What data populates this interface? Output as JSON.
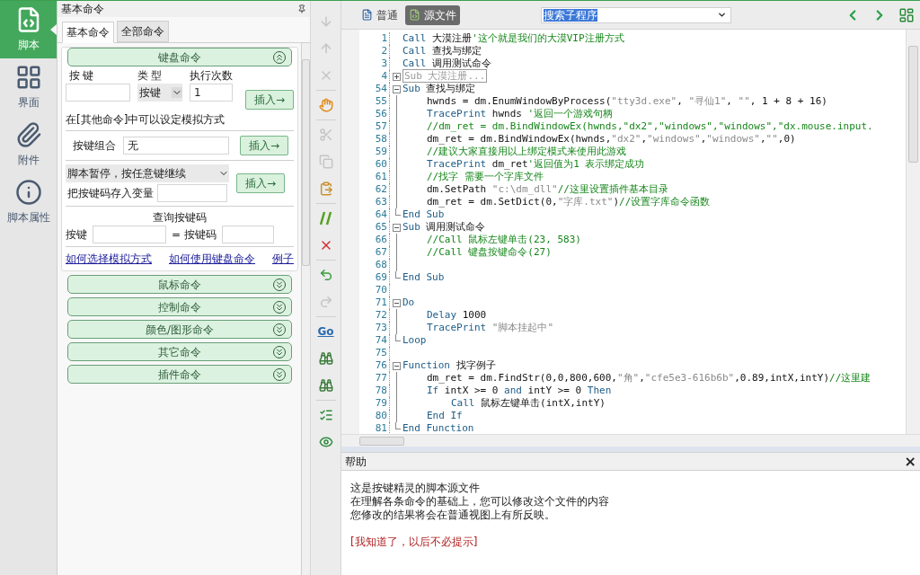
{
  "nav": [
    {
      "label": "脚本",
      "selected": true
    },
    {
      "label": "界面",
      "selected": false
    },
    {
      "label": "附件",
      "selected": false
    },
    {
      "label": "脚本属性",
      "selected": false
    }
  ],
  "panel": {
    "title": "基本命令",
    "tabs": [
      {
        "label": "基本命令",
        "selected": true
      },
      {
        "label": "全部命令",
        "selected": false
      }
    ],
    "sections": [
      {
        "title": "键盘命令",
        "expanded": true
      },
      {
        "title": "鼠标命令",
        "expanded": false
      },
      {
        "title": "控制命令",
        "expanded": false
      },
      {
        "title": "颜色/图形命令",
        "expanded": false
      },
      {
        "title": "其它命令",
        "expanded": false
      },
      {
        "title": "插件命令",
        "expanded": false
      }
    ],
    "keyboard": {
      "col_key": "按键",
      "col_type": "类型",
      "col_count": "执行次数",
      "type_value": "按键",
      "count_value": "1",
      "insert": "插入→",
      "note": "在[其他命令]中可以设定模拟方式",
      "combo_label": "按键组合",
      "combo_value": "无",
      "combo_insert": "插入→",
      "pause_value": "脚本暂停，按任意键继续",
      "store_label": "把按键码存入变量",
      "pause_insert": "插入→",
      "query_title": "查询按键码",
      "query_key": "按键",
      "query_code": "= 按键码",
      "links": [
        "如何选择模拟方式",
        "如何使用键盘命令",
        "例子"
      ]
    }
  },
  "tools": [
    {
      "disabled": true
    },
    {
      "disabled": true
    },
    {
      "disabled": true
    },
    {
      "disabled": false
    },
    {
      "disabled": true
    },
    {
      "disabled": true
    },
    {
      "disabled": false
    },
    {
      "disabled": false
    },
    {
      "disabled": false
    },
    {
      "disabled": false
    },
    {
      "disabled": true
    },
    {
      "disabled": false,
      "label": "Go"
    },
    {
      "disabled": false
    },
    {
      "disabled": false
    },
    {
      "disabled": false
    },
    {
      "disabled": false
    }
  ],
  "view_tabs": [
    {
      "label": "普通",
      "selected": false
    },
    {
      "label": "源文件",
      "selected": true
    }
  ],
  "sub_search": {
    "value": "搜索子程序"
  },
  "code": [
    {
      "no": "1",
      "kind": "line",
      "tokens": [
        {
          "kind": "keyword",
          "t": "Call"
        },
        {
          "kind": "text",
          "t": " 大漠注册"
        },
        {
          "kind": "comment",
          "t": "'这个就是我们的大漠VIP注册方式"
        }
      ]
    },
    {
      "no": "2",
      "kind": "line",
      "tokens": [
        {
          "kind": "keyword",
          "t": "Call"
        },
        {
          "kind": "text",
          "t": " 查找与绑定"
        }
      ]
    },
    {
      "no": "3",
      "kind": "line",
      "tokens": [
        {
          "kind": "keyword",
          "t": "Call"
        },
        {
          "kind": "text",
          "t": " 调用测试命令"
        }
      ]
    },
    {
      "no": "4",
      "kind": "block",
      "expanded": false,
      "tokens": [
        {
          "kind": "folded",
          "t": "Sub 大漠注册..."
        }
      ]
    },
    {
      "no": "54",
      "kind": "block",
      "expanded": true,
      "tokens": [
        {
          "kind": "keyword",
          "t": "Sub"
        },
        {
          "kind": "text",
          "t": " 查找与绑定"
        }
      ],
      "children": [
        {
          "no": "55",
          "kind": "line",
          "tokens": [
            {
              "kind": "text",
              "t": "hwnds = dm.EnumWindowByProcess("
            },
            {
              "kind": "string",
              "t": "\"tty3d.exe\""
            },
            {
              "kind": "text",
              "t": ", "
            },
            {
              "kind": "string",
              "t": "\"寻仙1\""
            },
            {
              "kind": "text",
              "t": ", "
            },
            {
              "kind": "string",
              "t": "\"\""
            },
            {
              "kind": "text",
              "t": ", 1 + 8 + 16)"
            }
          ]
        },
        {
          "no": "56",
          "kind": "line",
          "tokens": [
            {
              "kind": "keyword",
              "t": "TracePrint"
            },
            {
              "kind": "text",
              "t": " hwnds "
            },
            {
              "kind": "comment",
              "t": "'返回一个游戏句柄"
            }
          ]
        },
        {
          "no": "57",
          "kind": "line",
          "tokens": [
            {
              "kind": "comment",
              "t": "//dm_ret = dm.BindWindowEx(hwnds,\"dx2\",\"windows\",\"windows\",\"dx.mouse.input."
            }
          ]
        },
        {
          "no": "58",
          "kind": "line",
          "tokens": [
            {
              "kind": "text",
              "t": "dm_ret = dm.BindWindowEx(hwnds,"
            },
            {
              "kind": "string",
              "t": "\"dx2\""
            },
            {
              "kind": "text",
              "t": ","
            },
            {
              "kind": "string",
              "t": "\"windows\""
            },
            {
              "kind": "text",
              "t": ","
            },
            {
              "kind": "string",
              "t": "\"windows\""
            },
            {
              "kind": "text",
              "t": ","
            },
            {
              "kind": "string",
              "t": "\"\""
            },
            {
              "kind": "text",
              "t": ",0)"
            }
          ]
        },
        {
          "no": "59",
          "kind": "line",
          "tokens": [
            {
              "kind": "comment",
              "t": "//建议大家直接用以上绑定模式来使用此游戏"
            }
          ]
        },
        {
          "no": "60",
          "kind": "line",
          "tokens": [
            {
              "kind": "keyword",
              "t": "TracePrint"
            },
            {
              "kind": "text",
              "t": " dm_ret"
            },
            {
              "kind": "comment",
              "t": "'返回值为1 表示绑定成功"
            }
          ]
        },
        {
          "no": "61",
          "kind": "line",
          "tokens": [
            {
              "kind": "comment",
              "t": "//找字 需要一个字库文件"
            }
          ]
        },
        {
          "no": "62",
          "kind": "line",
          "tokens": [
            {
              "kind": "text",
              "t": "dm.SetPath "
            },
            {
              "kind": "string",
              "t": "\"c:\\dm_dll\""
            },
            {
              "kind": "comment",
              "t": "//这里设置插件基本目录"
            }
          ]
        },
        {
          "no": "63",
          "kind": "line",
          "tokens": [
            {
              "kind": "text",
              "t": "dm_ret = dm.SetDict(0,"
            },
            {
              "kind": "string",
              "t": "\"字库.txt\""
            },
            {
              "kind": "text",
              "t": ")"
            },
            {
              "kind": "comment",
              "t": "//设置字库命令函数"
            }
          ]
        }
      ]
    },
    {
      "no": "64",
      "kind": "end",
      "tokens": [
        {
          "kind": "keyword",
          "t": "End Sub"
        }
      ]
    },
    {
      "no": "65",
      "kind": "block",
      "expanded": true,
      "tokens": [
        {
          "kind": "keyword",
          "t": "Sub"
        },
        {
          "kind": "text",
          "t": " 调用测试命令"
        }
      ],
      "children": [
        {
          "no": "66",
          "kind": "line",
          "tokens": [
            {
              "kind": "comment",
              "t": "//Call 鼠标左键单击(23, 583)"
            }
          ]
        },
        {
          "no": "67",
          "kind": "line",
          "tokens": [
            {
              "kind": "comment",
              "t": "//Call 键盘按键命令(27)"
            }
          ]
        },
        {
          "no": "68",
          "kind": "line"
        }
      ]
    },
    {
      "no": "69",
      "kind": "end",
      "tokens": [
        {
          "kind": "keyword",
          "t": "End Sub"
        }
      ]
    },
    {
      "no": "70",
      "kind": "line"
    },
    {
      "no": "71",
      "kind": "block",
      "expanded": true,
      "tokens": [
        {
          "kind": "keyword",
          "t": "Do"
        }
      ],
      "children": [
        {
          "no": "72",
          "kind": "line",
          "tokens": [
            {
              "kind": "keyword",
              "t": "Delay"
            },
            {
              "kind": "text",
              "t": " 1000"
            }
          ]
        },
        {
          "no": "73",
          "kind": "line",
          "tokens": [
            {
              "kind": "keyword",
              "t": "TracePrint"
            },
            {
              "kind": "string",
              "t": " \"脚本挂起中\""
            }
          ]
        }
      ]
    },
    {
      "no": "74",
      "kind": "end",
      "tokens": [
        {
          "kind": "keyword",
          "t": "Loop"
        }
      ]
    },
    {
      "no": "75",
      "kind": "line"
    },
    {
      "no": "76",
      "kind": "block",
      "expanded": true,
      "tokens": [
        {
          "kind": "keyword",
          "t": "Function"
        },
        {
          "kind": "text",
          "t": " 找字例子"
        }
      ],
      "children": [
        {
          "no": "77",
          "kind": "line",
          "tokens": [
            {
              "kind": "text",
              "t": "dm_ret = dm.FindStr(0,0,800,600,"
            },
            {
              "kind": "string",
              "t": "\"角\""
            },
            {
              "kind": "text",
              "t": ","
            },
            {
              "kind": "string",
              "t": "\"cfe5e3-616b6b\""
            },
            {
              "kind": "text",
              "t": ",0.89,intX,intY)"
            },
            {
              "kind": "comment",
              "t": "//这里建"
            }
          ]
        },
        {
          "no": "78",
          "kind": "line",
          "tokens": [
            {
              "kind": "keyword",
              "t": "If"
            },
            {
              "kind": "text",
              "t": " intX >= 0 "
            },
            {
              "kind": "keyword",
              "t": "and"
            },
            {
              "kind": "text",
              "t": " intY >= 0 "
            },
            {
              "kind": "keyword",
              "t": "Then"
            }
          ],
          "children": [
            {
              "no": "79",
              "kind": "line",
              "tokens": [
                {
                  "kind": "keyword",
                  "t": "Call"
                },
                {
                  "kind": "text",
                  "t": " 鼠标左键单击(intX,intY)"
                }
              ]
            }
          ]
        },
        {
          "no": "80",
          "kind": "line",
          "tokens": [
            {
              "kind": "keyword",
              "t": "End If"
            }
          ]
        }
      ]
    },
    {
      "no": "81",
      "kind": "end",
      "tokens": [
        {
          "kind": "keyword",
          "t": "End Function"
        }
      ]
    }
  ],
  "help": {
    "title": "帮助",
    "close": "×",
    "lines": [
      "这是按键精灵的脚本源文件",
      "在理解各条命令的基础上，您可以修改这个文件的内容",
      "您修改的结果将会在普通视图上有所反映。"
    ],
    "link": "[我知道了，以后不必提示]"
  }
}
